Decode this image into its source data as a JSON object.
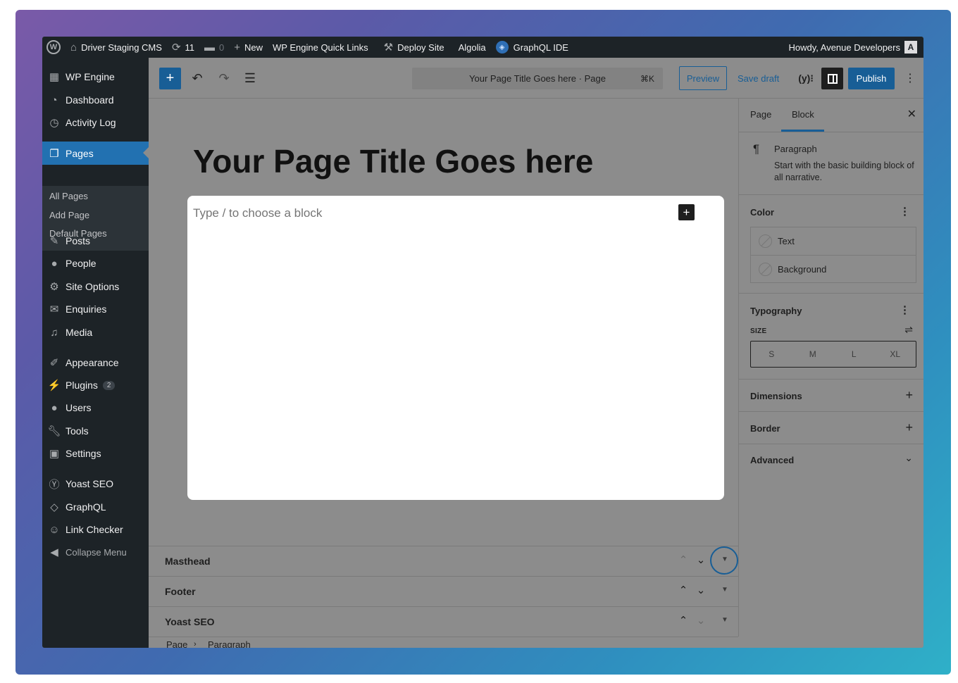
{
  "admin_bar": {
    "site_name": "Driver Staging CMS",
    "updates_count": "11",
    "comments_count": "0",
    "new_label": "New",
    "quick_links": "WP Engine Quick Links",
    "deploy": "Deploy Site",
    "algolia": "Algolia",
    "graphql_ide": "GraphQL IDE",
    "howdy": "Howdy, Avenue Developers"
  },
  "sidebar": {
    "items": [
      {
        "label": "WP Engine",
        "icon": "wp-engine-icon"
      },
      {
        "label": "Dashboard",
        "icon": "dashboard-icon"
      },
      {
        "label": "Activity Log",
        "icon": "history-icon"
      },
      {
        "label": "Pages",
        "icon": "pages-icon"
      },
      {
        "label": "Posts",
        "icon": "pin-icon"
      },
      {
        "label": "People",
        "icon": "user-icon"
      },
      {
        "label": "Site Options",
        "icon": "gear-icon"
      },
      {
        "label": "Enquiries",
        "icon": "mail-icon"
      },
      {
        "label": "Media",
        "icon": "media-icon"
      },
      {
        "label": "Appearance",
        "icon": "brush-icon"
      },
      {
        "label": "Plugins",
        "icon": "plug-icon",
        "badge": "2"
      },
      {
        "label": "Users",
        "icon": "user-icon"
      },
      {
        "label": "Tools",
        "icon": "wrench-icon"
      },
      {
        "label": "Settings",
        "icon": "settings-icon"
      },
      {
        "label": "Yoast SEO",
        "icon": "yoast-icon"
      },
      {
        "label": "GraphQL",
        "icon": "graphql-icon"
      },
      {
        "label": "Link Checker",
        "icon": "link-checker-icon"
      },
      {
        "label": "Collapse Menu",
        "icon": "collapse-icon"
      }
    ],
    "pages_submenu": [
      "All Pages",
      "Add Page",
      "Default Pages"
    ]
  },
  "toolbar": {
    "doc_title": "Your Page Title Goes here · Page",
    "shortcut": "⌘K",
    "preview": "Preview",
    "save_draft": "Save draft",
    "publish": "Publish"
  },
  "editor": {
    "page_title": "Your Page Title Goes here",
    "block_placeholder": "Type / to choose a block"
  },
  "metaboxes": [
    {
      "title": "Masthead"
    },
    {
      "title": "Footer"
    },
    {
      "title": "Yoast SEO"
    }
  ],
  "breadcrumb": [
    "Page",
    "Paragraph"
  ],
  "settings_panel": {
    "tabs": [
      "Page",
      "Block"
    ],
    "active_tab": "Block",
    "block_name": "Paragraph",
    "block_desc": "Start with the basic building block of all narrative.",
    "color_title": "Color",
    "color_options": [
      "Text",
      "Background"
    ],
    "typography_title": "Typography",
    "size_label": "SIZE",
    "sizes": [
      "S",
      "M",
      "L",
      "XL"
    ],
    "dimensions_title": "Dimensions",
    "border_title": "Border",
    "advanced_title": "Advanced"
  },
  "colors": {
    "accent": "#185e96",
    "admin_bar": "#1d2327",
    "active_menu": "#2271b1",
    "overlay": "#8c8c8c"
  }
}
